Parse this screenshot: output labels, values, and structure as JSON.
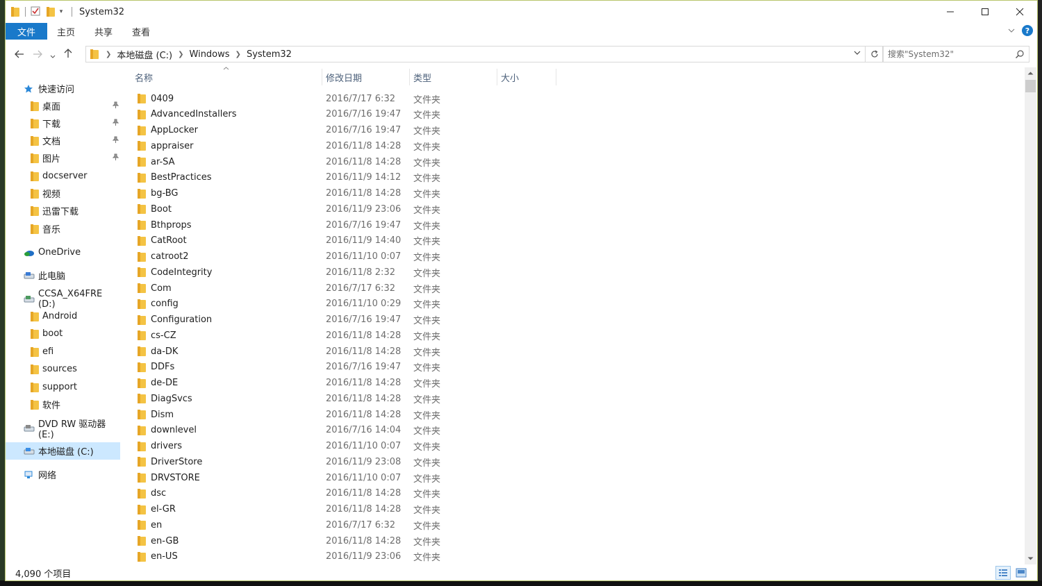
{
  "window": {
    "title": "System32",
    "controls": {
      "minimize": "—",
      "maximize": "☐",
      "close": "✕"
    }
  },
  "ribbon": {
    "tabs": [
      "文件",
      "主页",
      "共享",
      "查看"
    ],
    "help": "?"
  },
  "address": {
    "crumbs": [
      "本地磁盘 (C:)",
      "Windows",
      "System32"
    ],
    "search_placeholder": "搜索\"System32\""
  },
  "sidebar": {
    "items": [
      {
        "label": "快速访问",
        "icon": "star-icon",
        "level": 0,
        "pinned": false
      },
      {
        "label": "桌面",
        "icon": "desktop-folder-icon",
        "level": 1,
        "pinned": true
      },
      {
        "label": "下载",
        "icon": "download-folder-icon",
        "level": 1,
        "pinned": true
      },
      {
        "label": "文档",
        "icon": "documents-folder-icon",
        "level": 1,
        "pinned": true
      },
      {
        "label": "图片",
        "icon": "pictures-folder-icon",
        "level": 1,
        "pinned": true
      },
      {
        "label": "docserver",
        "icon": "folder-icon",
        "level": 1,
        "pinned": false
      },
      {
        "label": "视频",
        "icon": "videos-folder-icon",
        "level": 1,
        "pinned": false
      },
      {
        "label": "迅雷下载",
        "icon": "folder-icon",
        "level": 1,
        "pinned": false
      },
      {
        "label": "音乐",
        "icon": "music-folder-icon",
        "level": 1,
        "pinned": false
      },
      {
        "label": "OneDrive",
        "icon": "onedrive-icon",
        "level": 0,
        "pinned": false
      },
      {
        "label": "此电脑",
        "icon": "computer-icon",
        "level": 0,
        "pinned": false
      },
      {
        "label": "CCSA_X64FRE (D:)",
        "icon": "drive-icon",
        "level": 0,
        "pinned": false
      },
      {
        "label": "Android",
        "icon": "folder-icon",
        "level": 1,
        "pinned": false
      },
      {
        "label": "boot",
        "icon": "folder-icon",
        "level": 1,
        "pinned": false
      },
      {
        "label": "efi",
        "icon": "folder-icon",
        "level": 1,
        "pinned": false
      },
      {
        "label": "sources",
        "icon": "folder-icon",
        "level": 1,
        "pinned": false
      },
      {
        "label": "support",
        "icon": "folder-icon",
        "level": 1,
        "pinned": false
      },
      {
        "label": "软件",
        "icon": "folder-icon",
        "level": 1,
        "pinned": false
      },
      {
        "label": "DVD RW 驱动器 (E:)",
        "icon": "dvd-drive-icon",
        "level": 0,
        "pinned": false
      },
      {
        "label": "本地磁盘 (C:)",
        "icon": "windows-drive-icon",
        "level": 0,
        "pinned": false,
        "selected": true
      },
      {
        "label": "网络",
        "icon": "network-icon",
        "level": 0,
        "pinned": false
      }
    ]
  },
  "columns": [
    "名称",
    "修改日期",
    "类型",
    "大小"
  ],
  "files": [
    {
      "name": "0409",
      "date": "2016/7/17 6:32",
      "type": "文件夹"
    },
    {
      "name": "AdvancedInstallers",
      "date": "2016/7/16 19:47",
      "type": "文件夹"
    },
    {
      "name": "AppLocker",
      "date": "2016/7/16 19:47",
      "type": "文件夹"
    },
    {
      "name": "appraiser",
      "date": "2016/11/8 14:28",
      "type": "文件夹"
    },
    {
      "name": "ar-SA",
      "date": "2016/11/8 14:28",
      "type": "文件夹"
    },
    {
      "name": "BestPractices",
      "date": "2016/11/9 14:12",
      "type": "文件夹"
    },
    {
      "name": "bg-BG",
      "date": "2016/11/8 14:28",
      "type": "文件夹"
    },
    {
      "name": "Boot",
      "date": "2016/11/9 23:06",
      "type": "文件夹"
    },
    {
      "name": "Bthprops",
      "date": "2016/7/16 19:47",
      "type": "文件夹"
    },
    {
      "name": "CatRoot",
      "date": "2016/11/9 14:40",
      "type": "文件夹"
    },
    {
      "name": "catroot2",
      "date": "2016/11/10 0:07",
      "type": "文件夹"
    },
    {
      "name": "CodeIntegrity",
      "date": "2016/11/8 2:32",
      "type": "文件夹"
    },
    {
      "name": "Com",
      "date": "2016/7/17 6:32",
      "type": "文件夹"
    },
    {
      "name": "config",
      "date": "2016/11/10 0:29",
      "type": "文件夹"
    },
    {
      "name": "Configuration",
      "date": "2016/7/16 19:47",
      "type": "文件夹"
    },
    {
      "name": "cs-CZ",
      "date": "2016/11/8 14:28",
      "type": "文件夹"
    },
    {
      "name": "da-DK",
      "date": "2016/11/8 14:28",
      "type": "文件夹"
    },
    {
      "name": "DDFs",
      "date": "2016/7/16 19:47",
      "type": "文件夹"
    },
    {
      "name": "de-DE",
      "date": "2016/11/8 14:28",
      "type": "文件夹"
    },
    {
      "name": "DiagSvcs",
      "date": "2016/11/8 14:28",
      "type": "文件夹"
    },
    {
      "name": "Dism",
      "date": "2016/11/8 14:28",
      "type": "文件夹"
    },
    {
      "name": "downlevel",
      "date": "2016/7/16 14:04",
      "type": "文件夹"
    },
    {
      "name": "drivers",
      "date": "2016/11/10 0:07",
      "type": "文件夹"
    },
    {
      "name": "DriverStore",
      "date": "2016/11/9 23:08",
      "type": "文件夹"
    },
    {
      "name": "DRVSTORE",
      "date": "2016/11/10 0:07",
      "type": "文件夹"
    },
    {
      "name": "dsc",
      "date": "2016/11/8 14:28",
      "type": "文件夹"
    },
    {
      "name": "el-GR",
      "date": "2016/11/8 14:28",
      "type": "文件夹"
    },
    {
      "name": "en",
      "date": "2016/7/17 6:32",
      "type": "文件夹"
    },
    {
      "name": "en-GB",
      "date": "2016/11/8 14:28",
      "type": "文件夹"
    },
    {
      "name": "en-US",
      "date": "2016/11/9 23:06",
      "type": "文件夹"
    }
  ],
  "status": {
    "item_count": "4,090 个项目"
  },
  "colors": {
    "accent": "#1979ca",
    "folder": "#f4c344",
    "selected": "#cce8ff"
  }
}
